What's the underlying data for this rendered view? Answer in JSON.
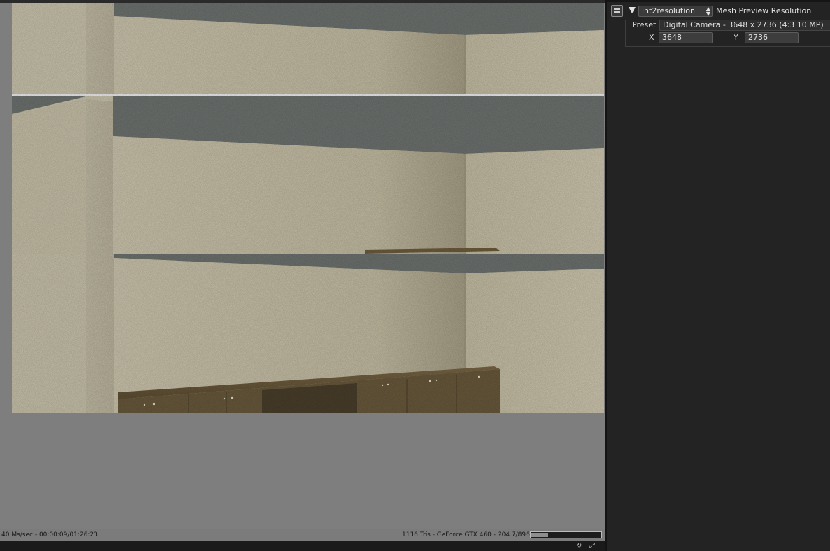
{
  "viewport": {
    "status_left": "40 Ms/sec - 00:00:09/01:26:23",
    "status_right": "1116 Tris - GeForce GTX 460 - 204.7/896 MB",
    "memory_used_fraction": 0.228
  },
  "inspector": {
    "node_name": "int2resolution",
    "node_title": "Mesh Preview Resolution",
    "preset_label": "Preset",
    "preset_value": "Digital Camera - 3648 x 2736 (4:3 10  MP)",
    "x_label": "X",
    "x_value": "3648",
    "y_label": "Y",
    "y_value": "2736"
  },
  "colors": {
    "wall": "#cbc5ae",
    "ceiling": "#6e7370",
    "counter": "#6b5a3b",
    "viewport_bg": "#7e7e7e",
    "panel_bg": "#232323"
  }
}
